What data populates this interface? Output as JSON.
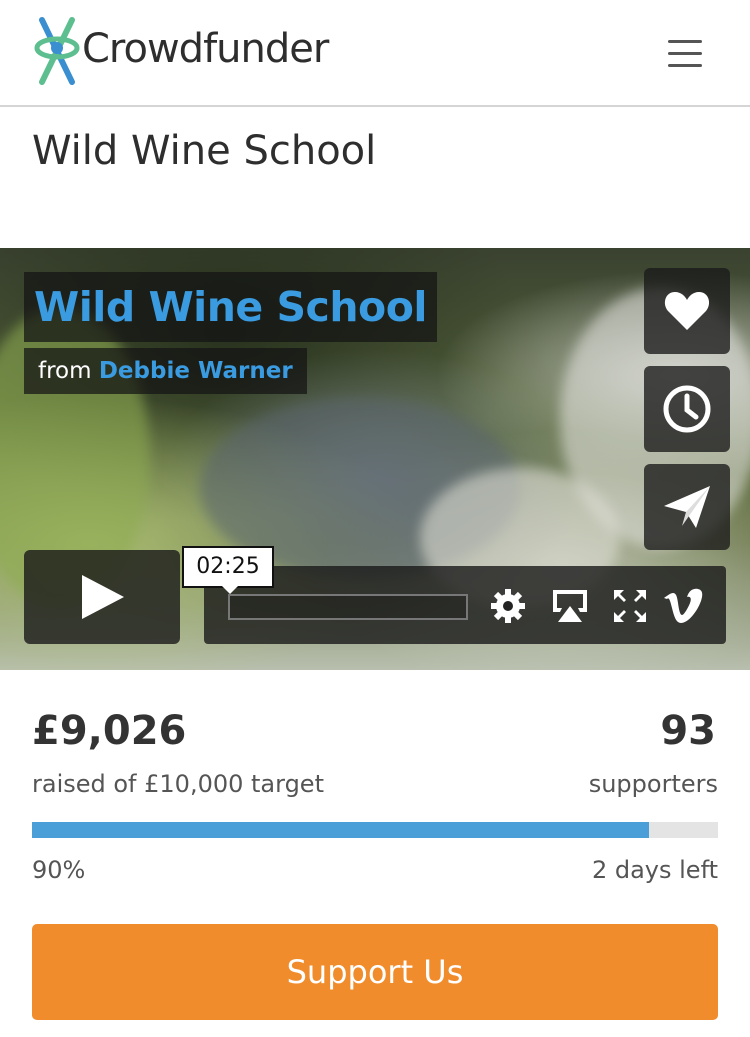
{
  "header": {
    "brand": "Crowdfunder",
    "menu_icon": "hamburger-icon"
  },
  "project": {
    "title": "Wild Wine School"
  },
  "video": {
    "title": "Wild Wine School",
    "from_label": "from",
    "author": "Debbie Warner",
    "time": "02:25",
    "side_icons": [
      "heart-icon",
      "clock-icon",
      "send-icon"
    ],
    "control_icons": [
      "play-icon",
      "settings-icon",
      "airplay-icon",
      "fullscreen-icon",
      "vimeo-icon"
    ]
  },
  "funding": {
    "amount": "£9,026",
    "raised_label": "raised of £10,000 target",
    "supporters_count": "93",
    "supporters_label": "supporters",
    "percent_label": "90%",
    "progress_fraction": 0.9,
    "days_left": "2 days left"
  },
  "cta": {
    "label": "Support Us"
  },
  "colors": {
    "accent_blue": "#4a9fd8",
    "cta_orange": "#f08c2c",
    "logo_green": "#5dbf8f",
    "logo_blue": "#3a8fd0"
  }
}
